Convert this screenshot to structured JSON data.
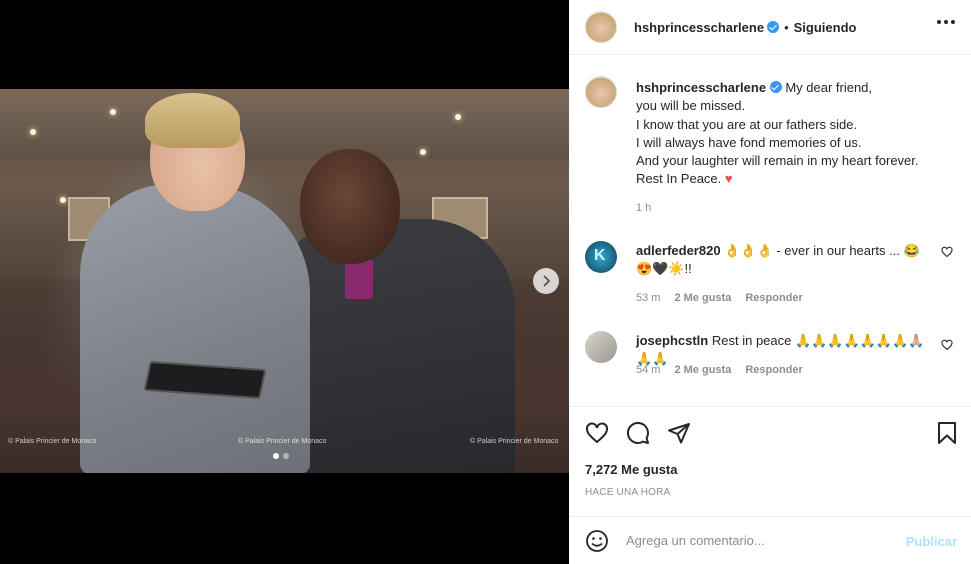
{
  "media": {
    "watermarks": [
      "© Palais Princier de Monaco",
      "© Palais Princier de Monaco",
      "© Palais Princier de Monaco"
    ],
    "carousel_total": 2,
    "carousel_current": 1,
    "next_icon": "chevron-right-icon"
  },
  "header": {
    "username": "hshprincesscharlene",
    "separator": "•",
    "follow_status": "Siguiendo",
    "more_icon": "more-options-icon"
  },
  "caption": {
    "username": "hshprincesscharlene",
    "text": "My dear friend,\nyou will be missed.\nI know that you are at our fathers side.\nI will always have fond memories of us.\nAnd your laughter will remain in my heart forever.\nRest In Peace.",
    "heart": "♥",
    "time": "1 h"
  },
  "comments": [
    {
      "username": "adlerfeder820",
      "text": "👌👌👌 - ever in our hearts ... 😂 😍🖤☀️!!",
      "time": "53 m",
      "likes": "2 Me gusta",
      "reply": "Responder"
    },
    {
      "username": "josephcstln",
      "text": "Rest in peace 🙏🙏🙏🙏🙏🙏🙏🙏🏼🙏🙏",
      "time": "54 m",
      "likes": "2 Me gusta",
      "reply": "Responder"
    }
  ],
  "actions": {
    "like_icon": "heart-icon",
    "comment_icon": "comment-icon",
    "share_icon": "share-icon",
    "save_icon": "bookmark-icon",
    "likes_count": "7,272 Me gusta",
    "post_time": "HACE UNA HORA"
  },
  "add_comment": {
    "placeholder": "Agrega un comentario...",
    "publish_label": "Publicar",
    "emoji_icon": "emoji-icon"
  },
  "colors": {
    "verified": "#3897f0",
    "publish_disabled": "#b2dffc",
    "heart": "#ed4956"
  }
}
